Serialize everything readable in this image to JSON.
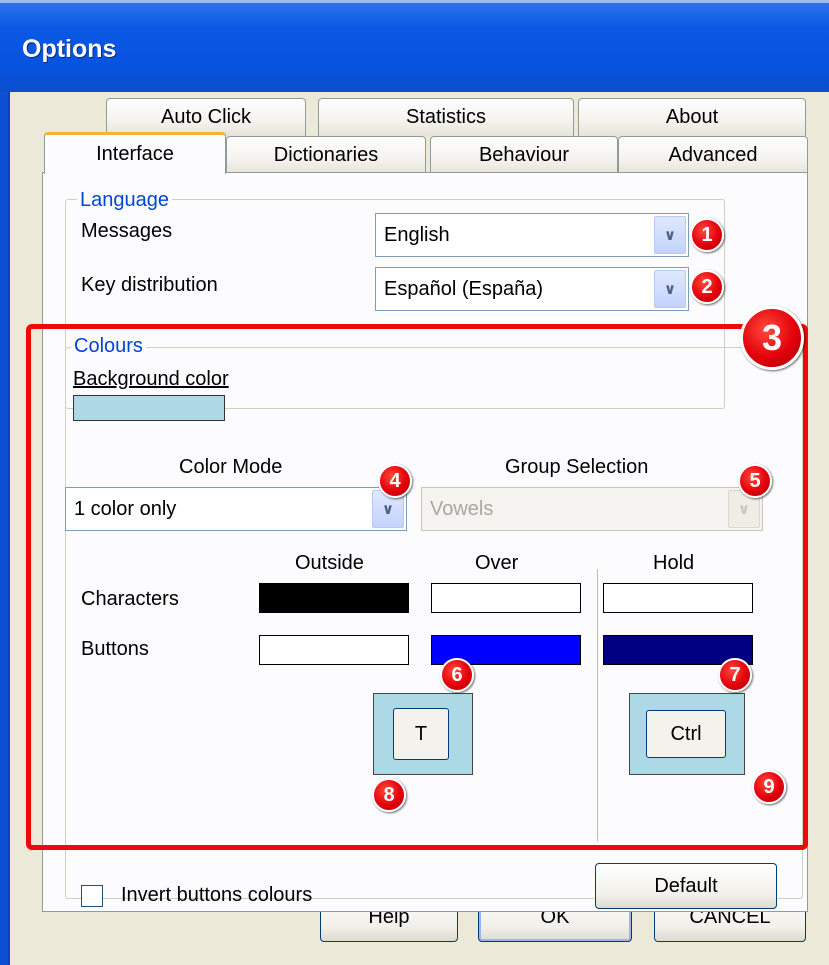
{
  "window": {
    "title": "Options"
  },
  "tabs": {
    "row1": [
      {
        "label": "Auto Click"
      },
      {
        "label": "Statistics"
      },
      {
        "label": "About"
      }
    ],
    "row2": [
      {
        "label": "Interface"
      },
      {
        "label": "Dictionaries"
      },
      {
        "label": "Behaviour"
      },
      {
        "label": "Advanced"
      }
    ],
    "active": "Interface"
  },
  "language": {
    "legend": "Language",
    "messages_label": "Messages",
    "messages_value": "English",
    "keydist_label": "Key distribution",
    "keydist_value": "Español (España)"
  },
  "colours": {
    "legend": "Colours",
    "background_label": "Background color",
    "background_color": "#add8e6",
    "color_mode_label": "Color Mode",
    "color_mode_value": "1 color only",
    "group_selection_label": "Group Selection",
    "group_selection_value": "Vowels",
    "col_outside": "Outside",
    "col_over": "Over",
    "col_hold": "Hold",
    "row_characters": "Characters",
    "row_buttons": "Buttons",
    "swatches": {
      "characters_outside": "#000000",
      "characters_over": "#ffffff",
      "characters_hold": "#ffffff",
      "buttons_outside": "#ffffff",
      "buttons_over": "#0000ff",
      "buttons_hold": "#000080"
    },
    "preview_over_label": "T",
    "preview_hold_label": "Ctrl",
    "invert_label": "Invert buttons colours",
    "invert_checked": false,
    "default_button": "Default"
  },
  "badges": [
    "1",
    "2",
    "3",
    "4",
    "5",
    "6",
    "7",
    "8",
    "9"
  ],
  "footer": {
    "help": "Help",
    "ok": "OK",
    "cancel": "CANCEL"
  },
  "accent_colors": {
    "titlebar": "#0a58e4",
    "highlight": "#ee0a0a",
    "badge": "#e3000b",
    "legend": "#0046d5"
  }
}
